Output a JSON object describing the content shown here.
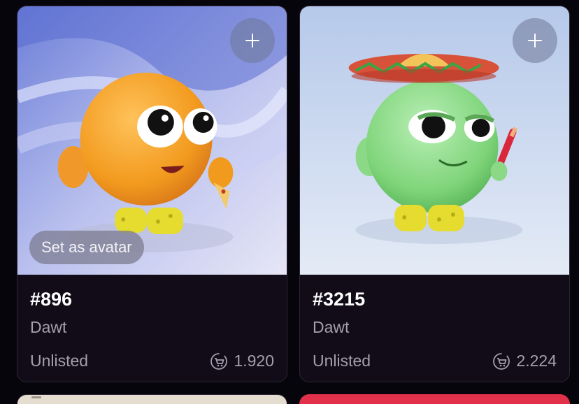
{
  "cards": [
    {
      "token_id": "#896",
      "collection": "Dawt",
      "status": "Unlisted",
      "price": "1.920",
      "avatar_button": "Set as avatar",
      "image": "orange-dawt-character-holding-pizza",
      "add_icon": "plus-icon",
      "price_icon": "cart-icon"
    },
    {
      "token_id": "#3215",
      "collection": "Dawt",
      "status": "Unlisted",
      "price": "2.224",
      "image": "green-dawt-character-with-sombrero-and-pencil",
      "add_icon": "plus-icon",
      "price_icon": "cart-icon"
    }
  ],
  "partial_cards": [
    {
      "background": "#e4ddd0"
    },
    {
      "background": "#e0304a"
    }
  ],
  "colors": {
    "page_background": "#07050c",
    "card_background": "#110c18",
    "muted_text": "#a39fae"
  }
}
